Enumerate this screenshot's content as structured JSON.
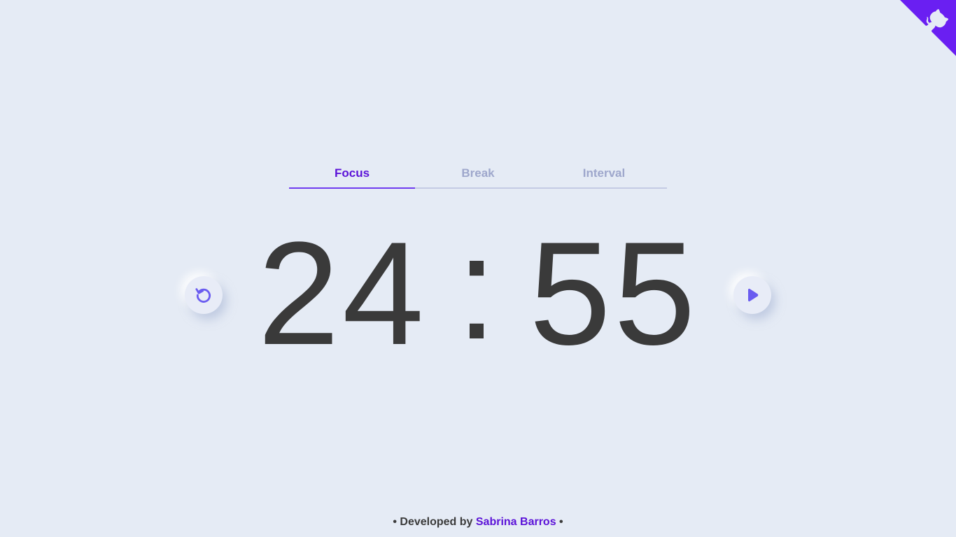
{
  "github_corner": {
    "icon": "github-octocat-icon",
    "color": "#6a1ff2"
  },
  "tabs": [
    {
      "label": "Focus",
      "active": true
    },
    {
      "label": "Break",
      "active": false
    },
    {
      "label": "Interval",
      "active": false
    }
  ],
  "timer": {
    "minutes": "24",
    "separator": ":",
    "seconds": "55"
  },
  "controls": {
    "reset_icon": "reset-icon",
    "play_icon": "play-icon",
    "accent": "#6a5cf0"
  },
  "footer": {
    "prefix": "• Developed by",
    "author": "Sabrina Barros",
    "suffix": "•"
  },
  "colors": {
    "background": "#e5ebf5",
    "active_tab": "#5b12d8",
    "inactive_tab": "#9ea7cc",
    "timer_text": "#3a3a3a"
  }
}
